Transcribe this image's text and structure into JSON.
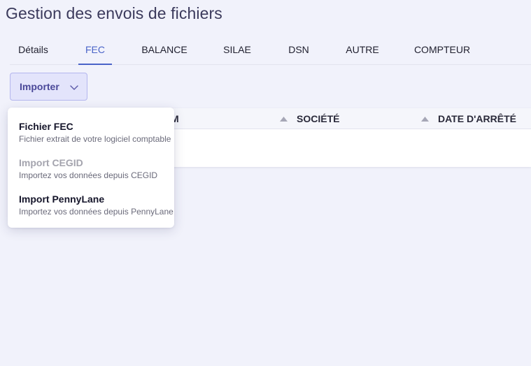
{
  "page": {
    "title": "Gestion des envois de fichiers"
  },
  "tabs": [
    {
      "label": "Détails",
      "active": false
    },
    {
      "label": "FEC",
      "active": true
    },
    {
      "label": "BALANCE",
      "active": false
    },
    {
      "label": "SILAE",
      "active": false
    },
    {
      "label": "DSN",
      "active": false
    },
    {
      "label": "AUTRE",
      "active": false
    },
    {
      "label": "COMPTEUR",
      "active": false
    }
  ],
  "import_button": {
    "label": "Importer",
    "icon": "chevron-down-icon"
  },
  "table": {
    "columns": [
      {
        "label": "M",
        "sort_icon": "sort-up-icon"
      },
      {
        "label": "SOCIÉTÉ",
        "sort_icon": "sort-up-icon"
      },
      {
        "label": "DATE D'ARRÊTÉ",
        "sort_icon": "sort-up-icon"
      }
    ]
  },
  "import_menu": {
    "items": [
      {
        "title": "Fichier FEC",
        "description": "Fichier extrait de votre logiciel comptable",
        "disabled": false
      },
      {
        "title": "Import CEGID",
        "description": "Importez vos données depuis CEGID",
        "disabled": true
      },
      {
        "title": "Import PennyLane",
        "description": "Importez vos données depuis PennyLane",
        "disabled": false
      }
    ]
  },
  "colors": {
    "accent": "#4a64c8",
    "button_bg": "#e3e4fb",
    "button_text": "#4a4899",
    "page_bg": "#f1f2fb"
  }
}
